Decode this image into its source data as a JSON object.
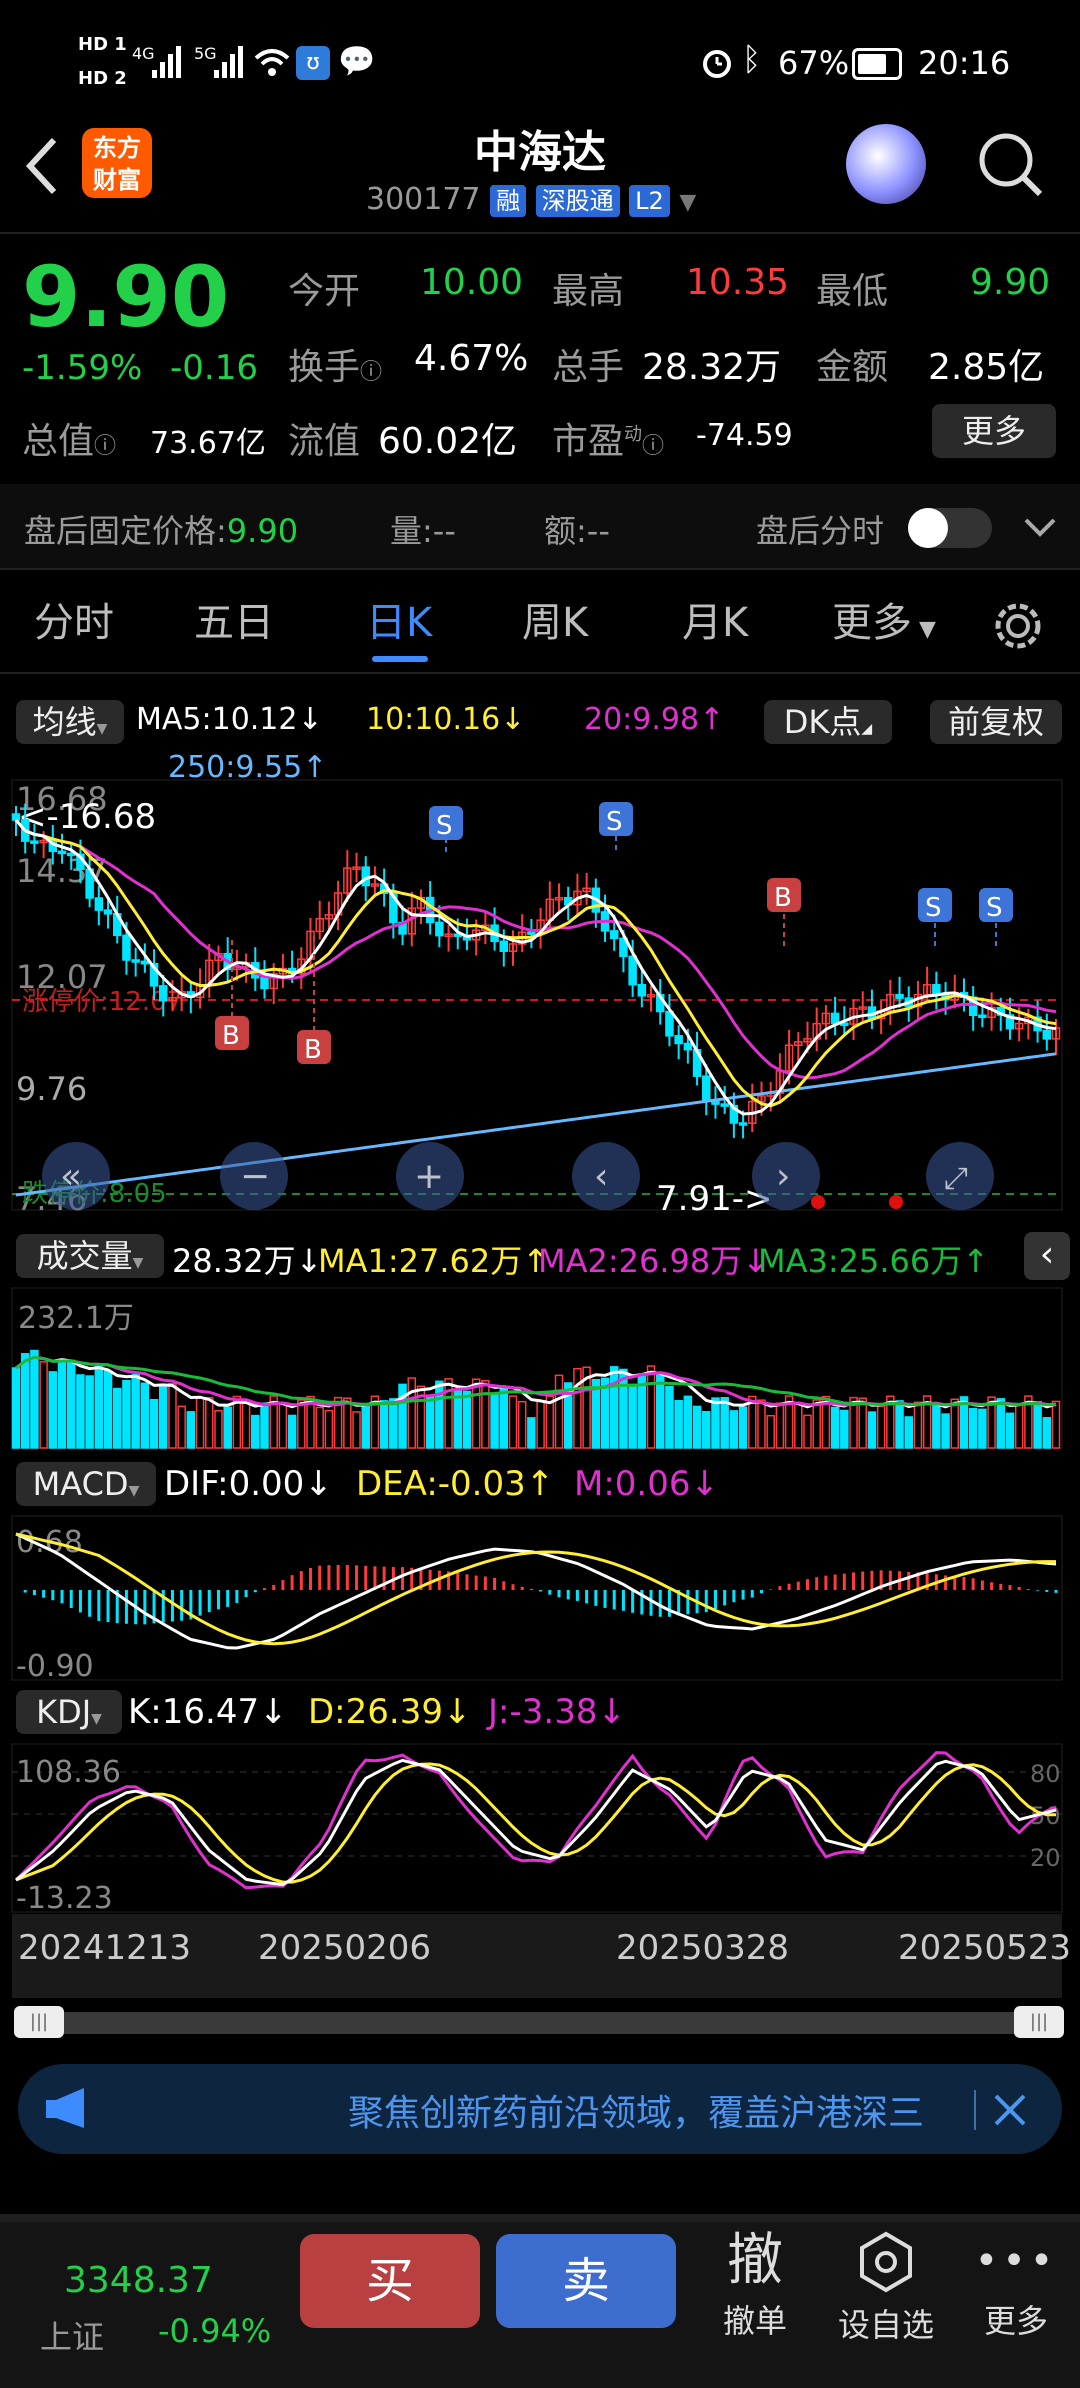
{
  "status_bar": {
    "hd1": "HD 1",
    "hd2": "HD 2",
    "net1": "4G",
    "net2": "5G",
    "battery": "67%",
    "time": "20:16"
  },
  "header": {
    "logo_line1": "东方",
    "logo_line2": "财富",
    "title": "中海达",
    "code": "300177",
    "badge_rong": "融",
    "badge_sgt": "深股通",
    "badge_l2": "L2"
  },
  "quote": {
    "price": "9.90",
    "change_pct": "-1.59%",
    "change": "-0.16",
    "open_label": "今开",
    "open": "10.00",
    "high_label": "最高",
    "high": "10.35",
    "low_label": "最低",
    "low": "9.90",
    "turnover_label": "换手",
    "turnover": "4.67%",
    "volume_label": "总手",
    "volume": "28.32万",
    "amount_label": "金额",
    "amount": "2.85亿",
    "mktcap_label": "总值",
    "mktcap": "73.67亿",
    "float_label": "流值",
    "float_cap": "60.02亿",
    "pe_label": "市盈",
    "pe_sup": "动",
    "pe": "-74.59",
    "more_btn": "更多"
  },
  "afterhours": {
    "price_label": "盘后固定价格:",
    "price": "9.90",
    "vol_label": "量:",
    "vol": "--",
    "amt_label": "额:",
    "amt": "--",
    "timeshare_label": "盘后分时"
  },
  "tabs": [
    "分时",
    "五日",
    "日K",
    "周K",
    "月K",
    "更多"
  ],
  "kline": {
    "ma_btn": "均线",
    "ma5": "MA5:10.12",
    "ma10": "10:10.16",
    "ma20": "20:9.98",
    "ma250": "250:9.55",
    "dk_btn": "DK点",
    "fq_btn": "前复权",
    "y_top": "16.68",
    "y_top_arrow": "<-16.68",
    "y_mid1": "14.37",
    "y_mid2": "12.07",
    "y_mid3": "9.76",
    "y_bottom": "7.46",
    "limit_up": "涨停价:12.07",
    "limit_down": "跌停价:8.05",
    "low_arrow": "7.91->",
    "sig_b": "B",
    "sig_s": "S",
    "colors": {
      "up": "#ff3b3b",
      "down": "#00e5ff",
      "ma5": "#ffffff",
      "ma10": "#ffee33",
      "ma20": "#e030d0",
      "ma250": "#66b8ff"
    }
  },
  "volume": {
    "btn": "成交量",
    "cur": "28.32万",
    "ma1": "MA1:27.62万",
    "ma2": "MA2:26.98万",
    "ma3": "MA3:25.66万",
    "y_top": "232.1万"
  },
  "macd": {
    "btn": "MACD",
    "dif": "DIF:0.00",
    "dea": "DEA:-0.03",
    "m": "M:0.06",
    "y_top": "0.68",
    "y_bottom": "-0.90"
  },
  "kdj": {
    "btn": "KDJ",
    "k": "K:16.47",
    "d": "D:26.39",
    "j": "J:-3.38",
    "y_top": "108.36",
    "y_bottom": "-13.23",
    "r80": "80",
    "r50": "50",
    "r20": "20"
  },
  "dates": [
    "20241213",
    "20250206",
    "20250328",
    "20250523"
  ],
  "banner": {
    "text": "聚焦创新药前沿领域，覆盖沪港深三"
  },
  "bottom": {
    "index_value": "3348.37",
    "index_name": "上证",
    "index_change": "-0.94%",
    "buy": "买",
    "sell": "卖",
    "cancel_big": "撤",
    "cancel": "撤单",
    "watch": "设自选",
    "more": "更多"
  }
}
